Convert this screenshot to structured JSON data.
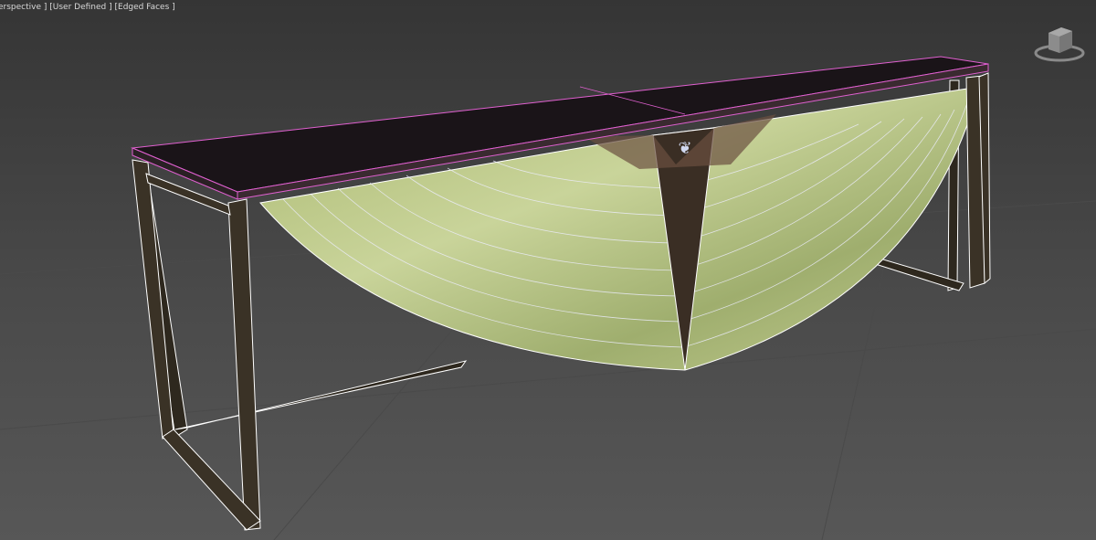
{
  "viewport": {
    "labels": {
      "view": "erspective ]",
      "shading_mode": "[User Defined ]",
      "edged": "[Edged Faces ]"
    },
    "viewcube_icon": "viewcube-icon",
    "colors": {
      "background": "#3c3c3c",
      "wire": "#ffffff",
      "selection_edge": "#e060d0",
      "panel": "#b8c880",
      "frame": "#3a3226"
    }
  }
}
